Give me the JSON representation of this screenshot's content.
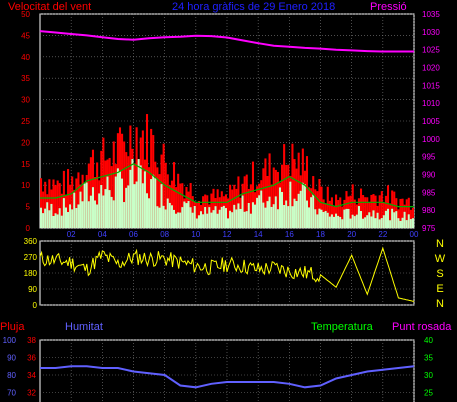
{
  "header": {
    "wind_label": "Velocitat del vent",
    "title": "24 hora gràfics de    29 Enero 2018",
    "pressure_label": "Pressió"
  },
  "legend2": {
    "rain": "Pluja",
    "humidity": "Humitat",
    "temperature": "Temperatura",
    "dewpoint": "Punt rosada"
  },
  "colors": {
    "background": "#000000",
    "grid": "#7f7f7f",
    "wind_gust": "#ff0000",
    "wind_avg": "#c8ffc8",
    "wind_avg_line": "#00b000",
    "pressure": "#ff00ff",
    "direction": "#ffff00",
    "axis_left": "#ff0000",
    "axis_pressure": "#ff00ff",
    "time_labels": "#4040ff",
    "humidity": "#6060ff",
    "temperature": "#00ff00"
  },
  "chart_data": [
    {
      "type": "line",
      "title": "24 hora gràfics de    29 Enero 2018",
      "x_ticks": [
        "02",
        "04",
        "06",
        "08",
        "10",
        "12",
        "14",
        "16",
        "18",
        "20",
        "22",
        "00"
      ],
      "y_left_ticks": [
        "0",
        "5",
        "10",
        "15",
        "20",
        "25",
        "30",
        "35",
        "40",
        "45",
        "50"
      ],
      "y_left_range": [
        0,
        50
      ],
      "y_right_ticks": [
        "975",
        "980",
        "985",
        "990",
        "995",
        "1000",
        "1005",
        "1010",
        "1015",
        "1020",
        "1025",
        "1030",
        "1035"
      ],
      "y_right_range": [
        975,
        1035
      ],
      "series": [
        {
          "name": "Pressió",
          "x": [
            0,
            1,
            2,
            3,
            4,
            5,
            6,
            7,
            8,
            9,
            10,
            11,
            12,
            13,
            14,
            15,
            16,
            17,
            18,
            19,
            20,
            21,
            22,
            23,
            24
          ],
          "values": [
            1030.2,
            1029.8,
            1029.4,
            1029.0,
            1028.5,
            1028.0,
            1027.8,
            1028.2,
            1028.5,
            1028.6,
            1028.9,
            1028.8,
            1028.4,
            1027.6,
            1026.8,
            1026.1,
            1025.8,
            1025.5,
            1025.3,
            1025.0,
            1024.8,
            1024.6,
            1024.5,
            1024.5,
            1024.5
          ]
        },
        {
          "name": "Velocitat del vent",
          "x": [
            0,
            1,
            2,
            3,
            4,
            5,
            6,
            7,
            8,
            9,
            10,
            11,
            12,
            13,
            14,
            15,
            16,
            17,
            18,
            19,
            20,
            21,
            22,
            23,
            24
          ],
          "gust": [
            13,
            11,
            12,
            17,
            18,
            20,
            25,
            23,
            17,
            12,
            9,
            8,
            8,
            12,
            14,
            16,
            18,
            16,
            9,
            7,
            9,
            8,
            9,
            7,
            7
          ],
          "avg": [
            5,
            5,
            6,
            9,
            10,
            11,
            13,
            11,
            8,
            6,
            4,
            4,
            4,
            6,
            7,
            8,
            10,
            8,
            4,
            3,
            4,
            4,
            4,
            3,
            3
          ]
        }
      ]
    },
    {
      "type": "scatter",
      "title": "",
      "y_left_ticks": [
        "360",
        "270",
        "180",
        "90",
        "0"
      ],
      "y_range": [
        0,
        360
      ],
      "right_labels": [
        "N",
        "W",
        "S",
        "E",
        "N"
      ],
      "series": [
        {
          "name": "",
          "x": [
            0,
            1,
            2,
            3,
            4,
            5,
            6,
            7,
            8,
            9,
            10,
            11,
            12,
            13,
            14,
            15,
            16,
            17,
            18,
            19,
            20,
            21,
            22,
            23,
            24
          ],
          "values": [
            260,
            250,
            240,
            200,
            280,
            230,
            270,
            260,
            260,
            240,
            220,
            210,
            230,
            220,
            200,
            210,
            190,
            180,
            170,
            100,
            280,
            60,
            320,
            40,
            20
          ]
        }
      ]
    },
    {
      "type": "line",
      "title": "",
      "y_left_ticks": [
        "100",
        "90",
        "80",
        "70"
      ],
      "y_humidity_range": [
        60,
        100
      ],
      "y_rain_ticks": [
        "38",
        "36",
        "34",
        "32"
      ],
      "y_rain_range": [
        30,
        38
      ],
      "y_right_ticks": [
        "40",
        "35",
        "30",
        "25"
      ],
      "y_temp_range": [
        20,
        40
      ],
      "series": [
        {
          "name": "Humitat",
          "x": [
            0,
            1,
            2,
            3,
            4,
            5,
            6,
            7,
            8,
            9,
            10,
            11,
            12,
            13,
            14,
            15,
            16,
            17,
            18,
            19,
            20,
            21,
            22,
            23,
            24
          ],
          "values": [
            84,
            84,
            85,
            85,
            84,
            84,
            82,
            81,
            80,
            74,
            73,
            75,
            76,
            76,
            76,
            76,
            75,
            73,
            74,
            78,
            80,
            82,
            83,
            84,
            85
          ]
        }
      ]
    }
  ]
}
